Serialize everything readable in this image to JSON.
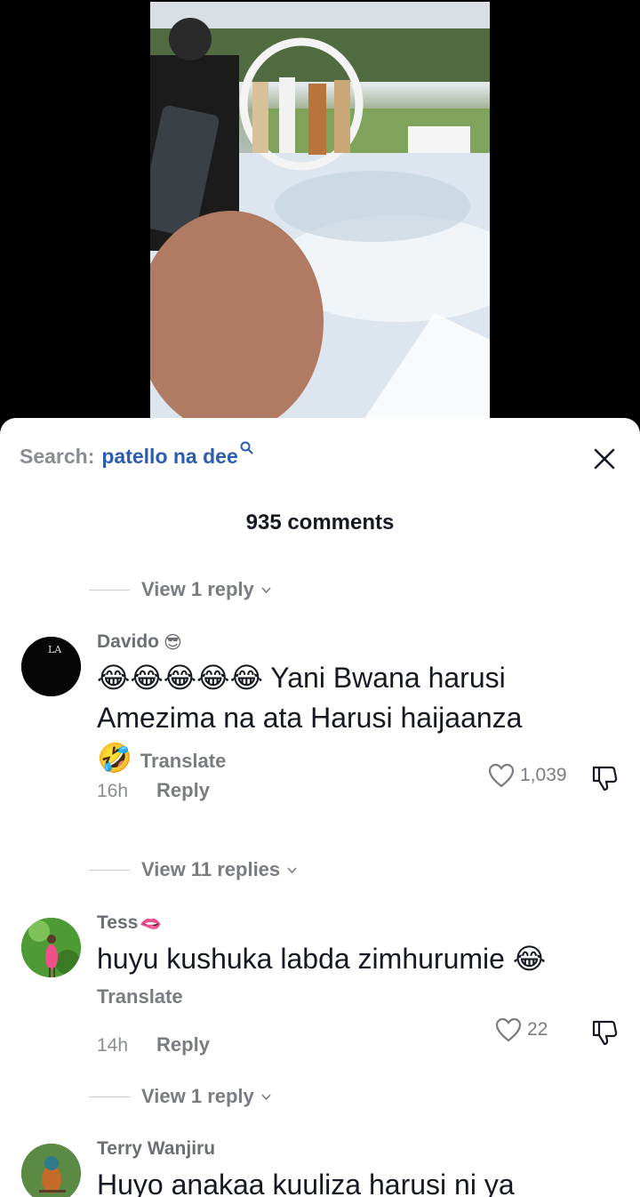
{
  "sheet": {
    "search_prefix": "Search:",
    "search_term": "patello na dee",
    "comments_count": "935 comments"
  },
  "replies": [
    {
      "label": "View 1 reply"
    },
    {
      "label": "View 11 replies"
    },
    {
      "label": "View 1 reply"
    }
  ],
  "comments": [
    {
      "username": "Davido",
      "username_emoji": "😎",
      "text_line1_emoji": "😂😂😂😂😂",
      "text_line1": "Yani Bwana harusi",
      "text_line2": "Amezima na ata Harusi haijaanza",
      "text_line3_emoji": "🤣",
      "translate": "Translate",
      "time": "16h",
      "reply": "Reply",
      "likes": "1,039"
    },
    {
      "username": "Tess",
      "username_emoji": "🫦",
      "text": "huyu kushuka labda zimhurumie",
      "text_emoji": "😂",
      "translate": "Translate",
      "time": "14h",
      "reply": "Reply",
      "likes": "22"
    },
    {
      "username": "Terry Wanjiru",
      "text": "Huyo anakaa kuuliza harusi ni ya"
    }
  ],
  "icons": {
    "search": "search-icon",
    "close": "close-icon",
    "like": "heart-outline-icon",
    "dislike": "thumbs-down-icon",
    "chevron": "chevron-down-icon"
  },
  "colors": {
    "search_term": "#2a5db0",
    "text": "#161823",
    "muted": "#7a7c83"
  }
}
